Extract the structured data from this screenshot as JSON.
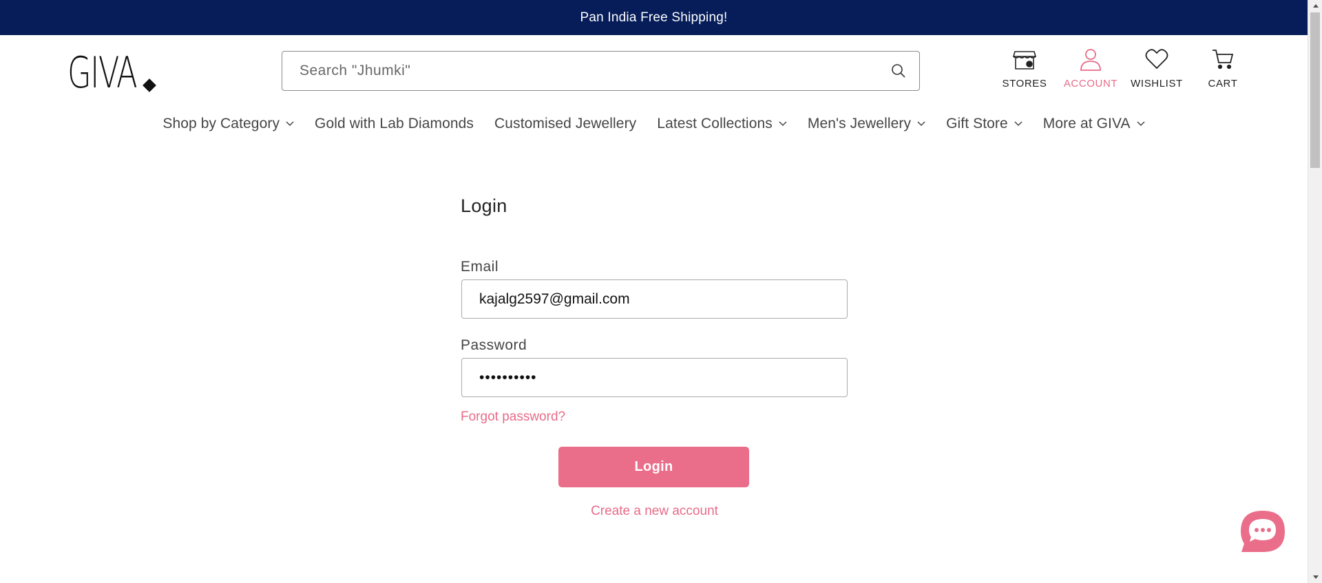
{
  "announcement": {
    "text": "Pan India Free Shipping!"
  },
  "header": {
    "logo_text": "GIVA",
    "search": {
      "placeholder": "Search \"Jhumki\""
    },
    "icons": [
      {
        "label": "STORES",
        "icon": "store-icon"
      },
      {
        "label": "ACCOUNT",
        "icon": "user-icon",
        "active": true
      },
      {
        "label": "WISHLIST",
        "icon": "heart-icon"
      },
      {
        "label": "CART",
        "icon": "cart-icon"
      }
    ]
  },
  "nav": {
    "items": [
      {
        "label": "Shop by Category",
        "has_dropdown": true
      },
      {
        "label": "Gold with Lab Diamonds",
        "has_dropdown": false
      },
      {
        "label": "Customised Jewellery",
        "has_dropdown": false
      },
      {
        "label": "Latest Collections",
        "has_dropdown": true
      },
      {
        "label": "Men's Jewellery",
        "has_dropdown": true
      },
      {
        "label": "Gift Store",
        "has_dropdown": true
      },
      {
        "label": "More at GIVA",
        "has_dropdown": true
      }
    ]
  },
  "login": {
    "title": "Login",
    "email_label": "Email",
    "email_value": "kajalg2597@gmail.com",
    "password_label": "Password",
    "password_value": "••••••••••",
    "forgot_link": "Forgot password?",
    "submit_label": "Login",
    "create_account_link": "Create a new account"
  },
  "colors": {
    "announcement_bg": "#061d59",
    "accent_pink": "#ea6d8a",
    "link_pink": "#e86b87"
  }
}
